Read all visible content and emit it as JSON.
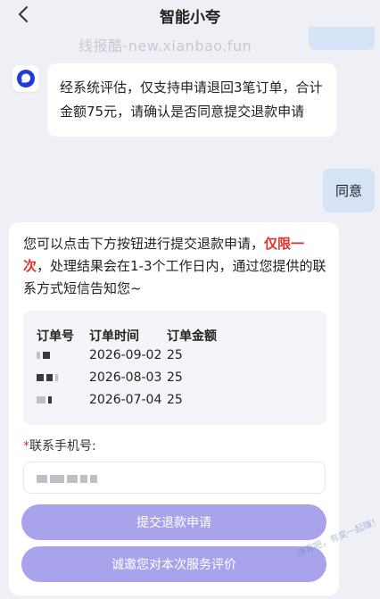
{
  "header": {
    "title": "智能小夸"
  },
  "watermark": "线报酷-new.xianbao.fun",
  "corner_watermark": "赚客吧，有奖一起赚！ zuanke8.com",
  "bot_message": "经系统评估，仅支持申请退回3笔订单，合计金额75元，请确认是否同意提交退款申请",
  "user_message": "同意",
  "card": {
    "intro_before": "您可以点击下方按钮进行提交退款申请，",
    "intro_highlight": "仅限一次",
    "intro_after": "，处理结果会在1-3个工作日内，通过您提供的联系方式短信告知您~",
    "table": {
      "headers": [
        "订单号",
        "订单时间",
        "订单金额"
      ],
      "rows": [
        {
          "time": "2026-09-02",
          "amount": "25"
        },
        {
          "time": "2026-08-03",
          "amount": "25"
        },
        {
          "time": "2026-07-04",
          "amount": "25"
        }
      ]
    },
    "phone_required_mark": "*",
    "phone_label": "联系手机号:",
    "submit_label": "提交退款申请",
    "rate_label": "诚邀您对本次服务评价"
  },
  "colors": {
    "accent": "#a9a3ec",
    "highlight": "#e0342b",
    "user_bubble": "#d6e3f7",
    "background": "#eef0f6"
  }
}
